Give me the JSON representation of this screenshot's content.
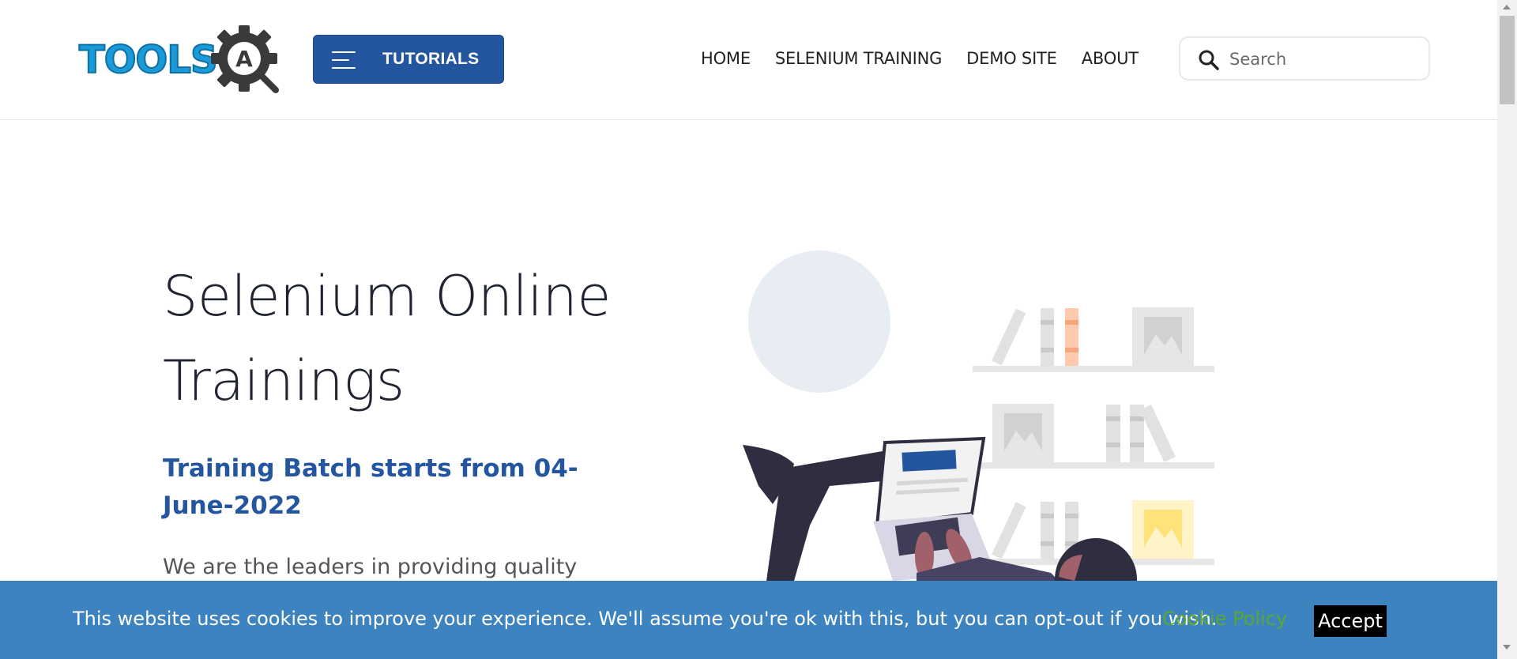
{
  "header": {
    "logo_text": "TOOLSQA",
    "tutorials_label": "TUTORIALS",
    "nav": [
      {
        "label": "HOME"
      },
      {
        "label": "SELENIUM TRAINING"
      },
      {
        "label": "DEMO SITE"
      },
      {
        "label": "ABOUT"
      }
    ],
    "search": {
      "placeholder": "Search",
      "value": ""
    }
  },
  "hero": {
    "title": "Selenium Online Trainings",
    "subtitle": "Training Batch starts from 04-June-2022",
    "description": "We are the leaders in providing quality"
  },
  "cookie": {
    "message": "This website uses cookies to improve your experience. We'll assume you're ok with this, but you can opt-out if you wish.",
    "policy_link": "Cookie Policy",
    "accept_label": "Accept"
  },
  "colors": {
    "brand_blue": "#2456a0",
    "cookie_bar": "#3d83c0",
    "cookie_link": "#5aa832",
    "logo_blue": "#1a9ad6"
  }
}
